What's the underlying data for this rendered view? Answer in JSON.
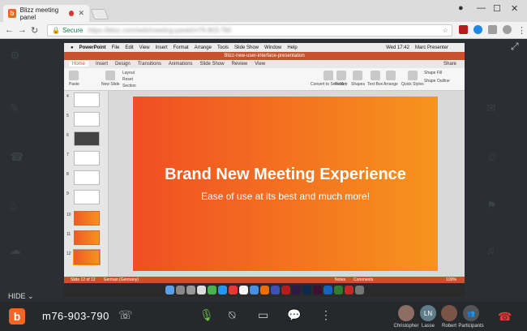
{
  "browser": {
    "tab_title": "Blizz meeting panel",
    "secure_label": "Secure",
    "url": "https://blizz.com/web/meeting-panel/m76-903-790"
  },
  "shared_screen": {
    "mac_menu": [
      "PowerPoint",
      "File",
      "Edit",
      "View",
      "Insert",
      "Format",
      "Arrange",
      "Tools",
      "Slide Show",
      "Window",
      "Help"
    ],
    "mac_clock": "Wed 17:42",
    "mac_user": "Marc Presenter",
    "doc_title": "Blizz-new-user-interface-presentation",
    "ribbon_tabs": [
      "Home",
      "Insert",
      "Design",
      "Transitions",
      "Animations",
      "Slide Show",
      "Review",
      "View"
    ],
    "ribbon_items": [
      "Paste",
      "New Slide",
      "Layout",
      "Reset",
      "Section",
      "Convert to SmartArt",
      "Picture",
      "Shapes",
      "Text Box",
      "Arrange",
      "Quick Styles",
      "Shape Fill",
      "Shape Outline"
    ],
    "share_label": "Share",
    "slide_numbers": [
      "4",
      "5",
      "6",
      "7",
      "8",
      "9",
      "10",
      "11",
      "12"
    ],
    "slide_title": "Brand New Meeting Experience",
    "slide_subtitle": "Ease of use at its best and much more!",
    "status_slide": "Slide 12 of 12",
    "status_lang": "German (Germany)",
    "status_notes": "Notes",
    "status_comments": "Comments",
    "status_zoom": "100%"
  },
  "bottom_bar": {
    "hide_label": "HIDE",
    "meeting_id": "m76-903-790",
    "participants": [
      {
        "name": "Christopher",
        "initials": "",
        "color": "#8d6e63"
      },
      {
        "name": "Lasse",
        "initials": "LN",
        "color": "#607d8b"
      },
      {
        "name": "Robert",
        "initials": "",
        "color": "#795548"
      },
      {
        "name": "Participants",
        "initials": "",
        "color": "#555"
      }
    ]
  },
  "colors": {
    "brand": "#f26522",
    "slide_start": "#f04e23",
    "slide_end": "#f7941d",
    "mic_active": "#6cc04a",
    "hangup": "#e53935"
  }
}
